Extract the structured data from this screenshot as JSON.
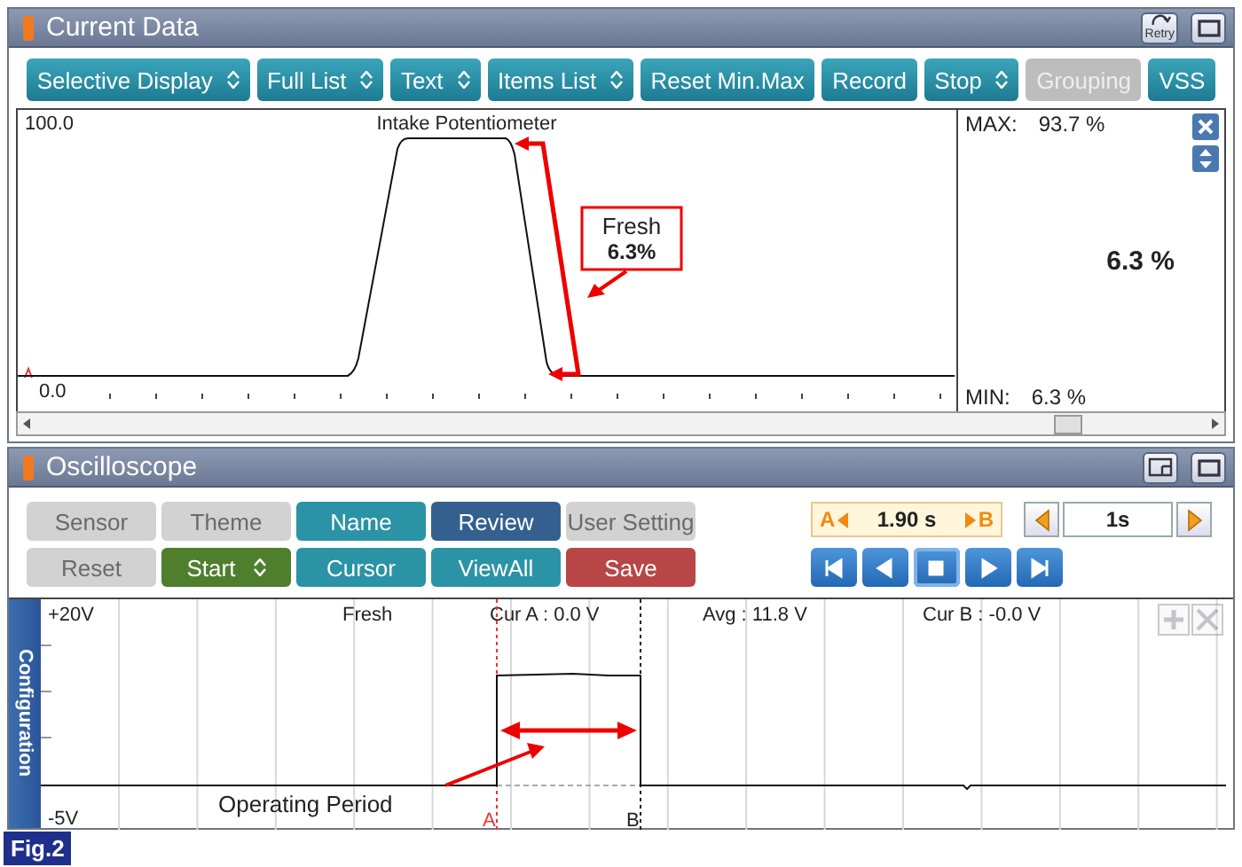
{
  "current_data": {
    "title": "Current Data",
    "retry_label": "Retry",
    "toolbar": [
      {
        "label": "Selective Display",
        "kind": "dropdown",
        "disabled": false
      },
      {
        "label": "Full List",
        "kind": "dropdown",
        "disabled": false
      },
      {
        "label": "Text",
        "kind": "dropdown",
        "disabled": false
      },
      {
        "label": "Items List",
        "kind": "dropdown",
        "disabled": false
      },
      {
        "label": "Reset Min.Max",
        "kind": "plain",
        "disabled": false
      },
      {
        "label": "Record",
        "kind": "plain",
        "disabled": false
      },
      {
        "label": "Stop",
        "kind": "dropdown",
        "disabled": false
      },
      {
        "label": "Grouping",
        "kind": "plain",
        "disabled": true
      },
      {
        "label": "VSS",
        "kind": "plain",
        "disabled": false
      }
    ],
    "graph": {
      "title": "Intake Potentiometer",
      "y_max": "100.0",
      "y_min": "0.0",
      "callout": {
        "title": "Fresh",
        "value": "6.3%"
      }
    },
    "readout": {
      "max_label": "MAX:",
      "max_value": "93.7 %",
      "value": "6.3 %",
      "min_label": "MIN:",
      "min_value": "6.3 %"
    }
  },
  "oscilloscope": {
    "title": "Oscilloscope",
    "buttons": [
      {
        "label": "Sensor",
        "kind": "plain",
        "disabled": true,
        "color": "#d2d2d2"
      },
      {
        "label": "Theme",
        "kind": "plain",
        "disabled": true,
        "color": "#d2d2d2"
      },
      {
        "label": "Name",
        "kind": "plain",
        "disabled": false,
        "color": "#2b93a6"
      },
      {
        "label": "Review",
        "kind": "plain",
        "disabled": false,
        "color": "#34608f"
      },
      {
        "label": "User Setting",
        "kind": "plain",
        "disabled": true,
        "color": "#d2d2d2"
      },
      {
        "label": "Reset",
        "kind": "plain",
        "disabled": true,
        "color": "#d2d2d2"
      },
      {
        "label": "Start",
        "kind": "dropdown",
        "disabled": false,
        "color": "#4f7f2c"
      },
      {
        "label": "Cursor",
        "kind": "plain",
        "disabled": false,
        "color": "#2b93a6"
      },
      {
        "label": "ViewAll",
        "kind": "plain",
        "disabled": false,
        "color": "#2b93a6"
      },
      {
        "label": "Save",
        "kind": "plain",
        "disabled": false,
        "color": "#b84646"
      }
    ],
    "cursor": {
      "a_label": "A",
      "interval": "1.90 s",
      "b_label": "B"
    },
    "time_div": "1s",
    "side_tab": "Configuration",
    "scope": {
      "y_max": "+20V",
      "y_min": "-5V",
      "channel": "Fresh",
      "cur_a": "Cur A : 0.0 V",
      "avg": "Avg : 11.8 V",
      "cur_b": "Cur B : -0.0 V",
      "marker_a": "A",
      "marker_b": "B",
      "annotation": "Operating Period"
    }
  },
  "figure_label": "Fig.2"
}
